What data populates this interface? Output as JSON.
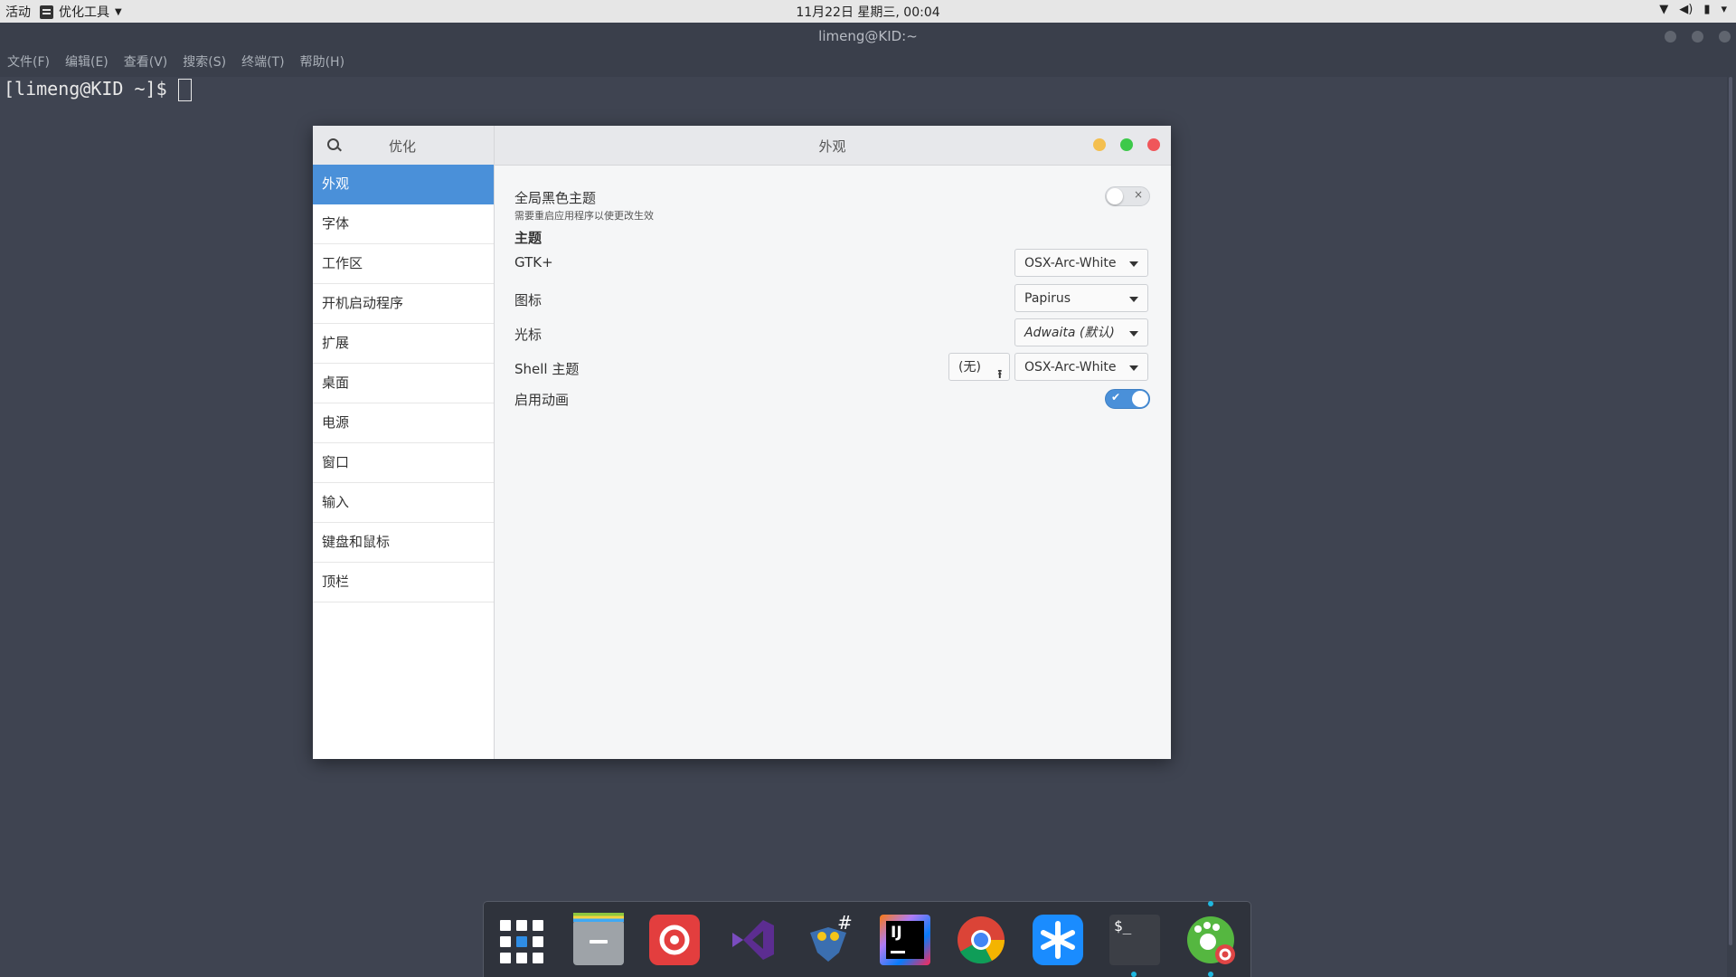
{
  "topbar": {
    "activities": "活动",
    "app_name": "优化工具",
    "clock": "11月22日 星期三, 00:04",
    "tray_icons": [
      "wifi-icon",
      "volume-icon",
      "battery-icon",
      "chevron-down-icon"
    ]
  },
  "terminal": {
    "title": "limeng@KID:~",
    "menu": [
      "文件(F)",
      "编辑(E)",
      "查看(V)",
      "搜索(S)",
      "终端(T)",
      "帮助(H)"
    ],
    "prompt": "[limeng@KID ~]$"
  },
  "tweaks": {
    "sidebar_title": "优化",
    "page_title": "外观",
    "sidebar_items": [
      "外观",
      "字体",
      "工作区",
      "开机启动程序",
      "扩展",
      "桌面",
      "电源",
      "窗口",
      "输入",
      "键盘和鼠标",
      "顶栏"
    ],
    "active_item": "外观",
    "dark_theme": {
      "label": "全局黑色主题",
      "sublabel": "需要重启应用程序以使更改生效",
      "enabled": false,
      "off_glyph": "×"
    },
    "themes_heading": "主题",
    "gtk": {
      "label": "GTK+",
      "value": "OSX-Arc-White"
    },
    "icons": {
      "label": "图标",
      "value": "Papirus"
    },
    "cursor": {
      "label": "光标",
      "value": "Adwaita (默认)"
    },
    "shell": {
      "label": "Shell 主题",
      "file_value": "(无)",
      "value": "OSX-Arc-White"
    },
    "animations": {
      "label": "启用动画",
      "enabled": true,
      "on_glyph": "✔"
    }
  },
  "dock": {
    "items": [
      "app-grid-icon",
      "files-icon",
      "netease-music-icon",
      "visual-studio-code-icon",
      "mono-develop-icon",
      "intellij-idea-icon",
      "chrome-icon",
      "dingtalk-icon",
      "terminal-icon",
      "gnome-tweaks-icon"
    ],
    "intellij_label": "IJ",
    "terminal_label": "$_"
  },
  "colors": {
    "accent": "#4a90d9",
    "minimize": "#f4bf4f",
    "maximize": "#3dc94a",
    "close": "#f0565a"
  }
}
